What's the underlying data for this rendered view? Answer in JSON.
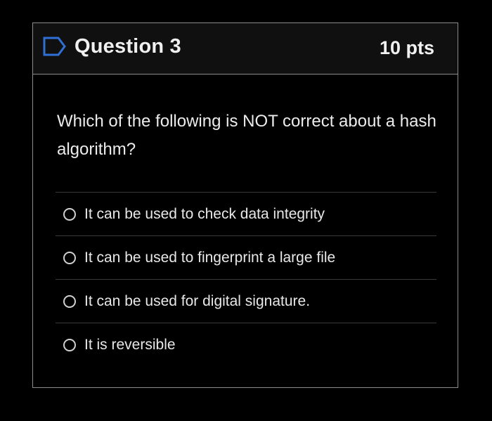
{
  "question": {
    "title": "Question 3",
    "points": "10 pts",
    "text": "Which of the following is NOT correct about a hash algorithm?",
    "flag_icon": "flag-outline-icon"
  },
  "answers": [
    {
      "label": "It can be used to check data integrity",
      "selected": false
    },
    {
      "label": "It can be used to fingerprint a large file",
      "selected": false
    },
    {
      "label": "It can be used for digital signature.",
      "selected": false
    },
    {
      "label": "It is reversible",
      "selected": false
    }
  ],
  "colors": {
    "background": "#000000",
    "header_background": "#101010",
    "border": "#8c8c8c",
    "flag": "#2f6fd6",
    "text": "#e8e8e8"
  }
}
